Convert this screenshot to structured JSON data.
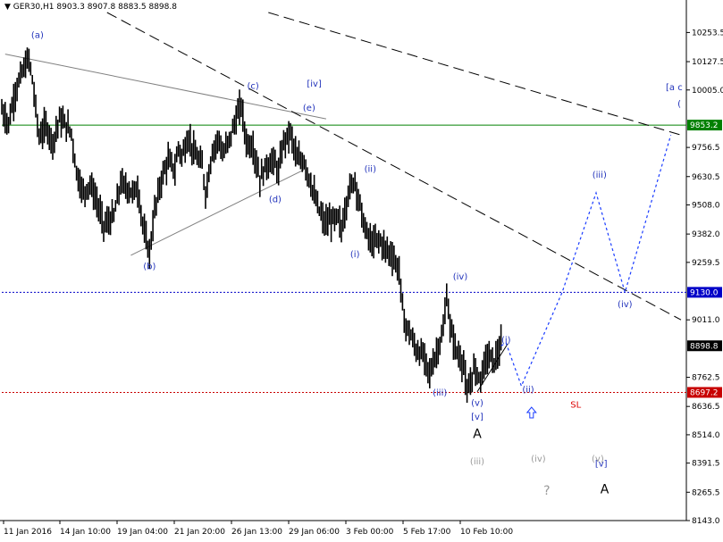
{
  "chart_data": {
    "type": "candlestick",
    "symbol": "GER30,H1",
    "ohlc_label": "8903.3 8907.8 8883.5 8898.8",
    "ylim": [
      8143.0,
      10340.0
    ],
    "y_ticks": [
      "10253.5",
      "10127.5",
      "10005.0",
      "9756.5",
      "9630.5",
      "9508.0",
      "9382.0",
      "9259.5",
      "9011.0",
      "8762.5",
      "8636.5",
      "8514.0",
      "8391.5",
      "8265.5",
      "8143.0"
    ],
    "x_ticks": [
      "11 Jan 2016",
      "14 Jan 10:00",
      "19 Jan 04:00",
      "21 Jan 20:00",
      "26 Jan 13:00",
      "29 Jan 06:00",
      "3 Feb 00:00",
      "5 Feb 17:00",
      "10 Feb 10:00"
    ],
    "price_path": [
      [
        0,
        9920
      ],
      [
        4,
        9860
      ],
      [
        8,
        10000
      ],
      [
        12,
        10080
      ],
      [
        16,
        10140
      ],
      [
        18,
        10050
      ],
      [
        22,
        9800
      ],
      [
        26,
        9850
      ],
      [
        30,
        9780
      ],
      [
        34,
        9880
      ],
      [
        38,
        9850
      ],
      [
        41,
        9820
      ],
      [
        44,
        9650
      ],
      [
        48,
        9560
      ],
      [
        52,
        9600
      ],
      [
        56,
        9520
      ],
      [
        60,
        9420
      ],
      [
        62,
        9430
      ],
      [
        66,
        9460
      ],
      [
        70,
        9600
      ],
      [
        74,
        9580
      ],
      [
        77,
        9560
      ],
      [
        80,
        9580
      ],
      [
        84,
        9380
      ],
      [
        87,
        9300
      ],
      [
        90,
        9480
      ],
      [
        94,
        9620
      ],
      [
        98,
        9700
      ],
      [
        102,
        9660
      ],
      [
        104,
        9760
      ],
      [
        106,
        9720
      ],
      [
        110,
        9800
      ],
      [
        114,
        9720
      ],
      [
        118,
        9680
      ],
      [
        120,
        9560
      ],
      [
        124,
        9740
      ],
      [
        128,
        9800
      ],
      [
        130,
        9720
      ],
      [
        134,
        9790
      ],
      [
        138,
        9880
      ],
      [
        141,
        9940
      ],
      [
        144,
        9780
      ],
      [
        148,
        9760
      ],
      [
        152,
        9620
      ],
      [
        156,
        9680
      ],
      [
        160,
        9700
      ],
      [
        163,
        9650
      ],
      [
        166,
        9780
      ],
      [
        170,
        9820
      ],
      [
        174,
        9700
      ],
      [
        178,
        9700
      ],
      [
        182,
        9600
      ],
      [
        186,
        9500
      ],
      [
        190,
        9430
      ],
      [
        194,
        9440
      ],
      [
        198,
        9450
      ],
      [
        200,
        9400
      ],
      [
        204,
        9560
      ],
      [
        208,
        9620
      ],
      [
        210,
        9540
      ],
      [
        214,
        9400
      ],
      [
        218,
        9340
      ],
      [
        222,
        9360
      ],
      [
        226,
        9320
      ],
      [
        230,
        9290
      ],
      [
        234,
        9220
      ],
      [
        237,
        9000
      ],
      [
        240,
        8960
      ],
      [
        244,
        8880
      ],
      [
        248,
        8860
      ],
      [
        252,
        8780
      ],
      [
        256,
        8870
      ],
      [
        260,
        8960
      ],
      [
        262,
        9120
      ],
      [
        264,
        8980
      ],
      [
        268,
        8870
      ],
      [
        272,
        8820
      ],
      [
        274,
        8680
      ],
      [
        278,
        8800
      ],
      [
        282,
        8760
      ],
      [
        286,
        8860
      ],
      [
        290,
        8830
      ],
      [
        294,
        8898.8
      ]
    ],
    "horizontal_levels": [
      {
        "value": 9853.2,
        "label": "9853.2",
        "style": "solid",
        "color": "#008000"
      },
      {
        "value": 9130.0,
        "label": "9130.0",
        "style": "dotted",
        "color": "#0000c8"
      },
      {
        "value": 8697.2,
        "label": "8697.2",
        "style": "dotted",
        "color": "#c80000"
      },
      {
        "value": 8898.8,
        "label": "8898.8",
        "style": "current",
        "color": "#000000"
      }
    ],
    "trend_lines": [
      {
        "style": "solid-gray",
        "from": [
          2,
          10160
        ],
        "to": [
          191,
          9880
        ]
      },
      {
        "style": "solid-gray",
        "from": [
          76,
          9290
        ],
        "to": [
          178,
          9660
        ]
      },
      {
        "style": "solid-black",
        "from": [
          280,
          8700
        ],
        "to": [
          298,
          8908
        ]
      },
      {
        "style": "dashed",
        "from": [
          62,
          10340
        ],
        "to": [
          400,
          9011
        ]
      },
      {
        "style": "dashed",
        "from": [
          157,
          10340
        ],
        "to": [
          400,
          9810
        ]
      }
    ],
    "forecast_path": [
      [
        294,
        8898.8
      ],
      [
        297,
        8910
      ],
      [
        306,
        8725
      ],
      [
        330,
        9130
      ],
      [
        350,
        9560
      ],
      [
        367,
        9130
      ],
      [
        394,
        9810
      ]
    ],
    "wave_labels": [
      {
        "text": "(a)",
        "at": [
          21,
          10230
        ],
        "color": "blue"
      },
      {
        "text": "(b)",
        "at": [
          87,
          9230
        ],
        "color": "blue"
      },
      {
        "text": "(c)",
        "at": [
          148,
          10010
        ],
        "color": "blue"
      },
      {
        "text": "(d)",
        "at": [
          161,
          9520
        ],
        "color": "blue"
      },
      {
        "text": "(e)",
        "at": [
          181,
          9915
        ],
        "color": "blue"
      },
      {
        "text": "[iv]",
        "at": [
          184,
          10020
        ],
        "color": "blue"
      },
      {
        "text": "(ii)",
        "at": [
          217,
          9650
        ],
        "color": "blue"
      },
      {
        "text": "(i)",
        "at": [
          208,
          9282
        ],
        "color": "blue"
      },
      {
        "text": "(iv)",
        "at": [
          270,
          9185
        ],
        "color": "blue"
      },
      {
        "text": "(iii)",
        "at": [
          258,
          8683
        ],
        "color": "blue"
      },
      {
        "text": "(i)",
        "at": [
          297,
          8912
        ],
        "color": "blue"
      },
      {
        "text": "(v)",
        "at": [
          280,
          8640
        ],
        "color": "blue"
      },
      {
        "text": "[v]",
        "at": [
          280,
          8579
        ],
        "color": "blue"
      },
      {
        "text": "(ii)",
        "at": [
          310,
          8698
        ],
        "color": "blue"
      },
      {
        "text": "(iii)",
        "at": [
          352,
          9625
        ],
        "color": "blue"
      },
      {
        "text": "(iv)",
        "at": [
          367,
          9065
        ],
        "color": "blue"
      },
      {
        "text": "[v]",
        "at": [
          353,
          8377
        ],
        "color": "blue"
      },
      {
        "text": "[a c",
        "at": [
          396,
          10005
        ],
        "color": "blue"
      },
      {
        "text": "(",
        "at": [
          399,
          9933
        ],
        "color": "blue"
      },
      {
        "text": "A",
        "at": [
          280,
          8500
        ],
        "color": "black"
      },
      {
        "text": "A",
        "at": [
          355,
          8261
        ],
        "color": "black"
      },
      {
        "text": "(iii)",
        "at": [
          280,
          8386
        ],
        "color": "gray"
      },
      {
        "text": "(iv)",
        "at": [
          316,
          8398
        ],
        "color": "gray"
      },
      {
        "text": "(v)",
        "at": [
          351,
          8398
        ],
        "color": "gray"
      },
      {
        "text": "?",
        "at": [
          321,
          8255
        ],
        "color": "gray"
      },
      {
        "text": "SL",
        "at": [
          338,
          8632
        ],
        "color": "red"
      }
    ],
    "arrow_up": {
      "at": [
        312,
        8610
      ]
    }
  }
}
